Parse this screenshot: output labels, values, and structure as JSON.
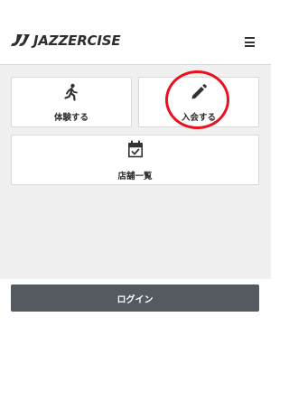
{
  "header": {
    "logo_text": "JAZZERCISE",
    "menu_icon": "hamburger-menu-icon"
  },
  "tiles": [
    {
      "label": "体験する",
      "icon": "running-person-icon"
    },
    {
      "label": "入会する",
      "icon": "pencil-icon"
    },
    {
      "label": "店舗一覧",
      "icon": "calendar-check-icon"
    }
  ],
  "login": {
    "label": "ログイン"
  },
  "colors": {
    "highlight_circle": "#e8121f",
    "login_button": "#555a61",
    "panel_background": "#f0f0f0"
  }
}
